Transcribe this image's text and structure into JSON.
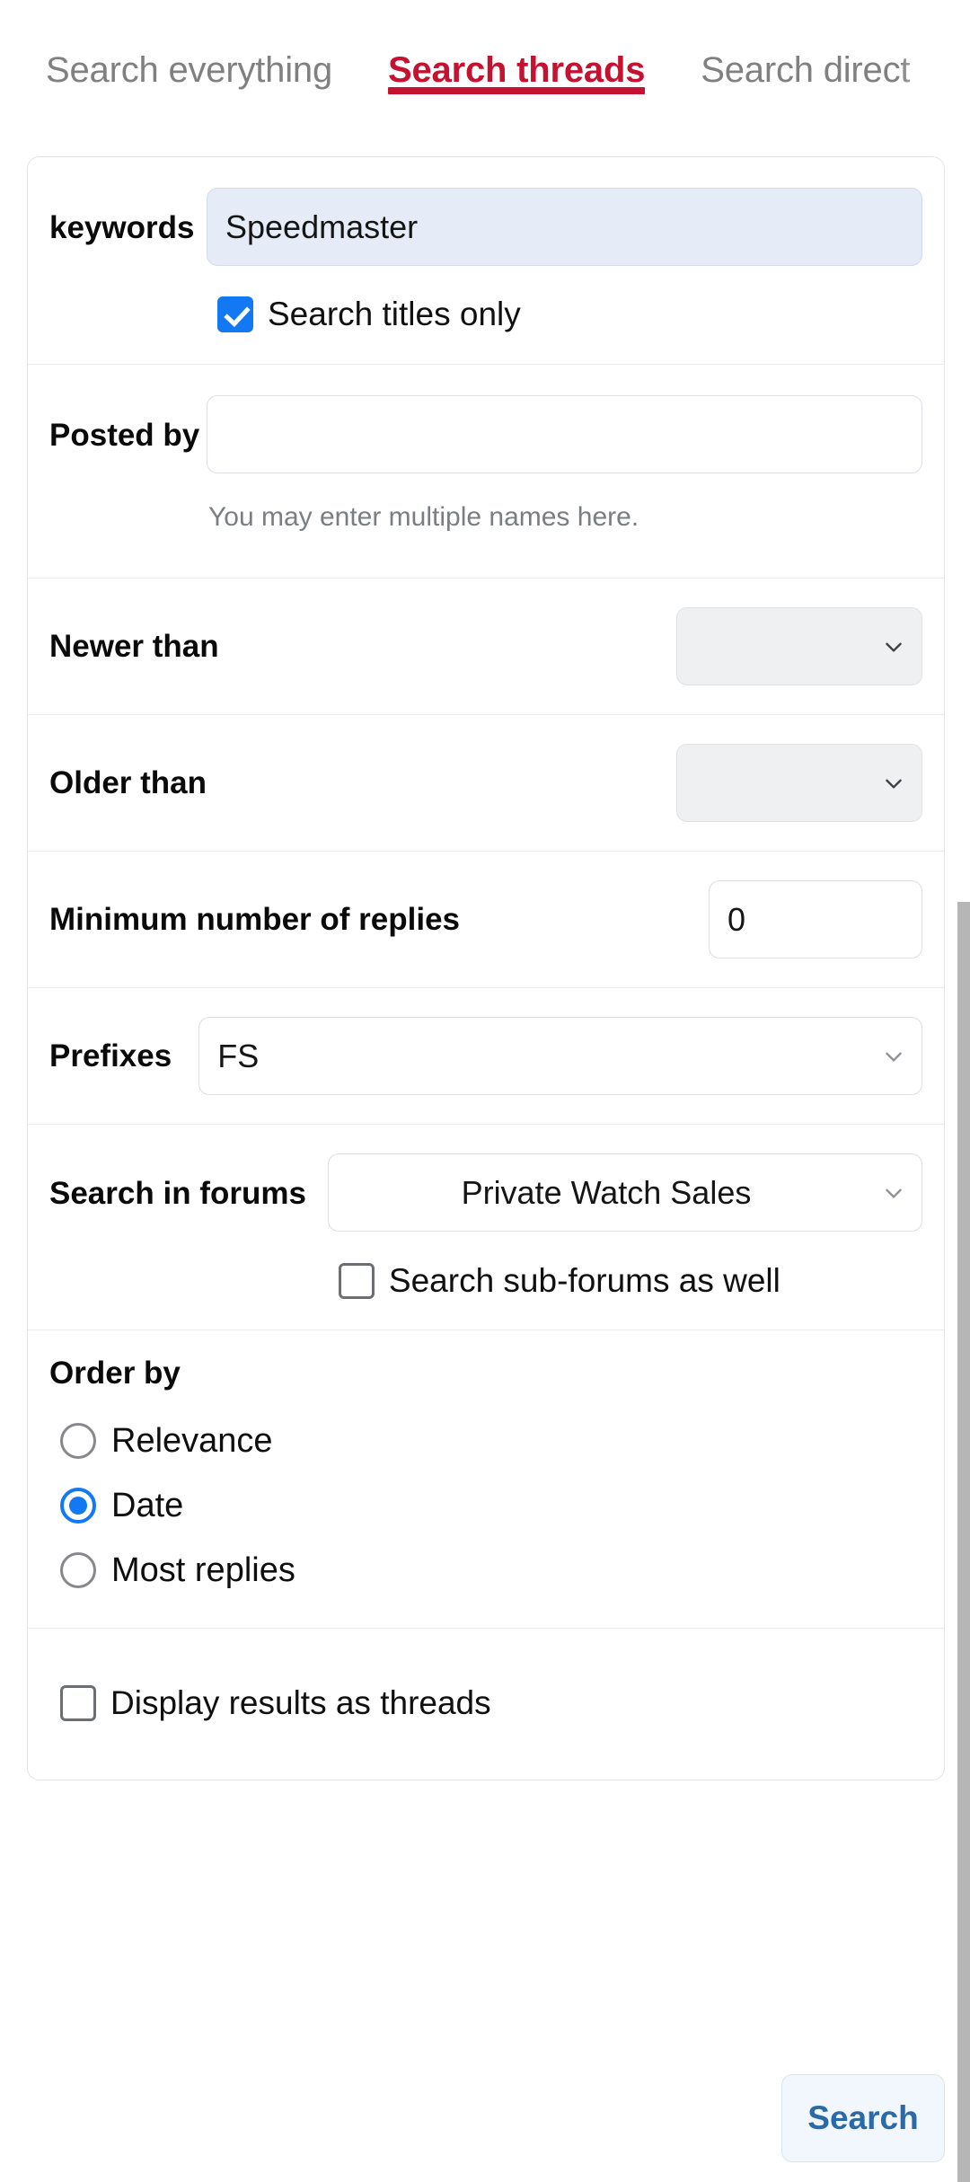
{
  "tabs": [
    {
      "label": "Search everything",
      "active": false
    },
    {
      "label": "Search threads",
      "active": true
    },
    {
      "label": "Search direct",
      "active": false
    }
  ],
  "form": {
    "keywords": {
      "label": "keywords",
      "value": "Speedmaster",
      "titles_only_label": "Search titles only",
      "titles_only_checked": "true"
    },
    "posted_by": {
      "label": "Posted by",
      "value": "",
      "hint": "You may enter multiple names here."
    },
    "newer_than": {
      "label": "Newer than",
      "value": ""
    },
    "older_than": {
      "label": "Older than",
      "value": ""
    },
    "min_replies": {
      "label": "Minimum number of replies",
      "value": "0"
    },
    "prefixes": {
      "label": "Prefixes",
      "value": "FS"
    },
    "search_in_forums": {
      "label": "Search in forums",
      "value": "Private Watch Sales",
      "subforums_label": "Search sub-forums as well",
      "subforums_checked": "false"
    },
    "order_by": {
      "label": "Order by",
      "options": [
        {
          "label": "Relevance",
          "selected": false
        },
        {
          "label": "Date",
          "selected": true
        },
        {
          "label": "Most replies",
          "selected": false
        }
      ]
    },
    "display_as_threads": {
      "label": "Display results as threads",
      "checked": "false"
    }
  },
  "actions": {
    "search_label": "Search"
  },
  "colors": {
    "accent_red": "#c41230",
    "checkbox_blue": "#1279f2",
    "button_text_blue": "#2a6aa8",
    "focused_input_bg": "#e5ecf8"
  }
}
